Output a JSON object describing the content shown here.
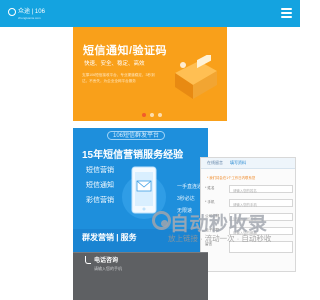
{
  "header": {
    "logo_text": "众途 | 106",
    "logo_sub": "zhongtusms.com",
    "bg_color": "#14a3e0"
  },
  "hero": {
    "title": "短信通知/验证码",
    "tags": "快速、安全、稳定、高效",
    "desc": "支撑106短信接收平台，专业渠道稳定，3秒到达，不丢失，为企业全网平台服务",
    "bg_color": "#f9a01a",
    "slide_index": 1,
    "slide_count": 3
  },
  "promo": {
    "badge": "106短信群发平台",
    "title": "15年短信营销服务经验",
    "left_items": [
      "短信营销",
      "短信通知",
      "彩信营销"
    ],
    "right_items": [
      "一手直连通道",
      "3秒必达",
      "无限速"
    ],
    "bottom_text": "群发营销 | 服务",
    "bg_color": "#1e8fdc"
  },
  "form": {
    "tabs": [
      "在线留言",
      "填写资料"
    ],
    "required_note": "* 我们将会在1个工作日内联系您",
    "rows": [
      {
        "label": "* 姓名",
        "placeholder": "请输入您的姓名"
      },
      {
        "label": "* 手机",
        "placeholder": "请输入您的手机"
      },
      {
        "label": "公司名称",
        "placeholder": "请输入公司名称"
      },
      {
        "label": "电子邮箱",
        "placeholder": "请输入您的邮箱"
      },
      {
        "label": "留言",
        "placeholder": ""
      }
    ]
  },
  "footer": {
    "title": "电话咨询",
    "subtitle": "请输入您的手机",
    "bg_color": "#5e6063"
  },
  "watermark": {
    "main": "自动秒收录",
    "sub": "放上链接 · 流动一次 · 自动秒收"
  }
}
